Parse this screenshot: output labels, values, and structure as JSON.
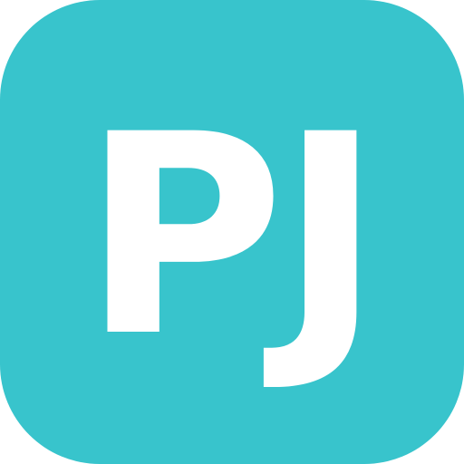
{
  "icon": {
    "monogram": "PJ",
    "background_color": "#38c4cc",
    "letter_color": "#ffffff"
  }
}
